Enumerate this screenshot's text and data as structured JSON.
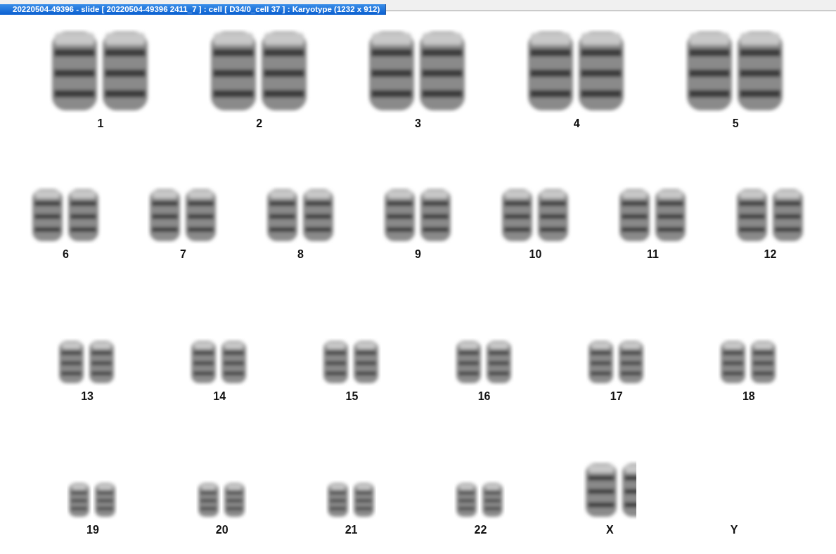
{
  "window": {
    "title": "20220504-49396 - slide [ 20220504-49396 2411_7 ] : cell [ D34/0_cell 37 ] : Karyotype  (1232 x 912)"
  },
  "karyotype_rows": [
    {
      "chromosomes": [
        {
          "label": "1",
          "kind": "pair"
        },
        {
          "label": "2",
          "kind": "pair"
        },
        {
          "label": "3",
          "kind": "pair"
        },
        {
          "label": "4",
          "kind": "pair"
        },
        {
          "label": "5",
          "kind": "pair"
        }
      ]
    },
    {
      "chromosomes": [
        {
          "label": "6",
          "kind": "pair"
        },
        {
          "label": "7",
          "kind": "pair"
        },
        {
          "label": "8",
          "kind": "pair"
        },
        {
          "label": "9",
          "kind": "pair"
        },
        {
          "label": "10",
          "kind": "pair"
        },
        {
          "label": "11",
          "kind": "pair"
        },
        {
          "label": "12",
          "kind": "pair"
        }
      ]
    },
    {
      "chromosomes": [
        {
          "label": "13",
          "kind": "pair"
        },
        {
          "label": "14",
          "kind": "pair"
        },
        {
          "label": "15",
          "kind": "pair"
        },
        {
          "label": "16",
          "kind": "pair"
        },
        {
          "label": "17",
          "kind": "pair"
        },
        {
          "label": "18",
          "kind": "pair"
        }
      ]
    },
    {
      "chromosomes": [
        {
          "label": "19",
          "kind": "pair"
        },
        {
          "label": "20",
          "kind": "pair"
        },
        {
          "label": "21",
          "kind": "pair"
        },
        {
          "label": "22",
          "kind": "pair"
        },
        {
          "label": "X",
          "kind": "pair"
        },
        {
          "label": "Y",
          "kind": "none"
        }
      ]
    }
  ]
}
